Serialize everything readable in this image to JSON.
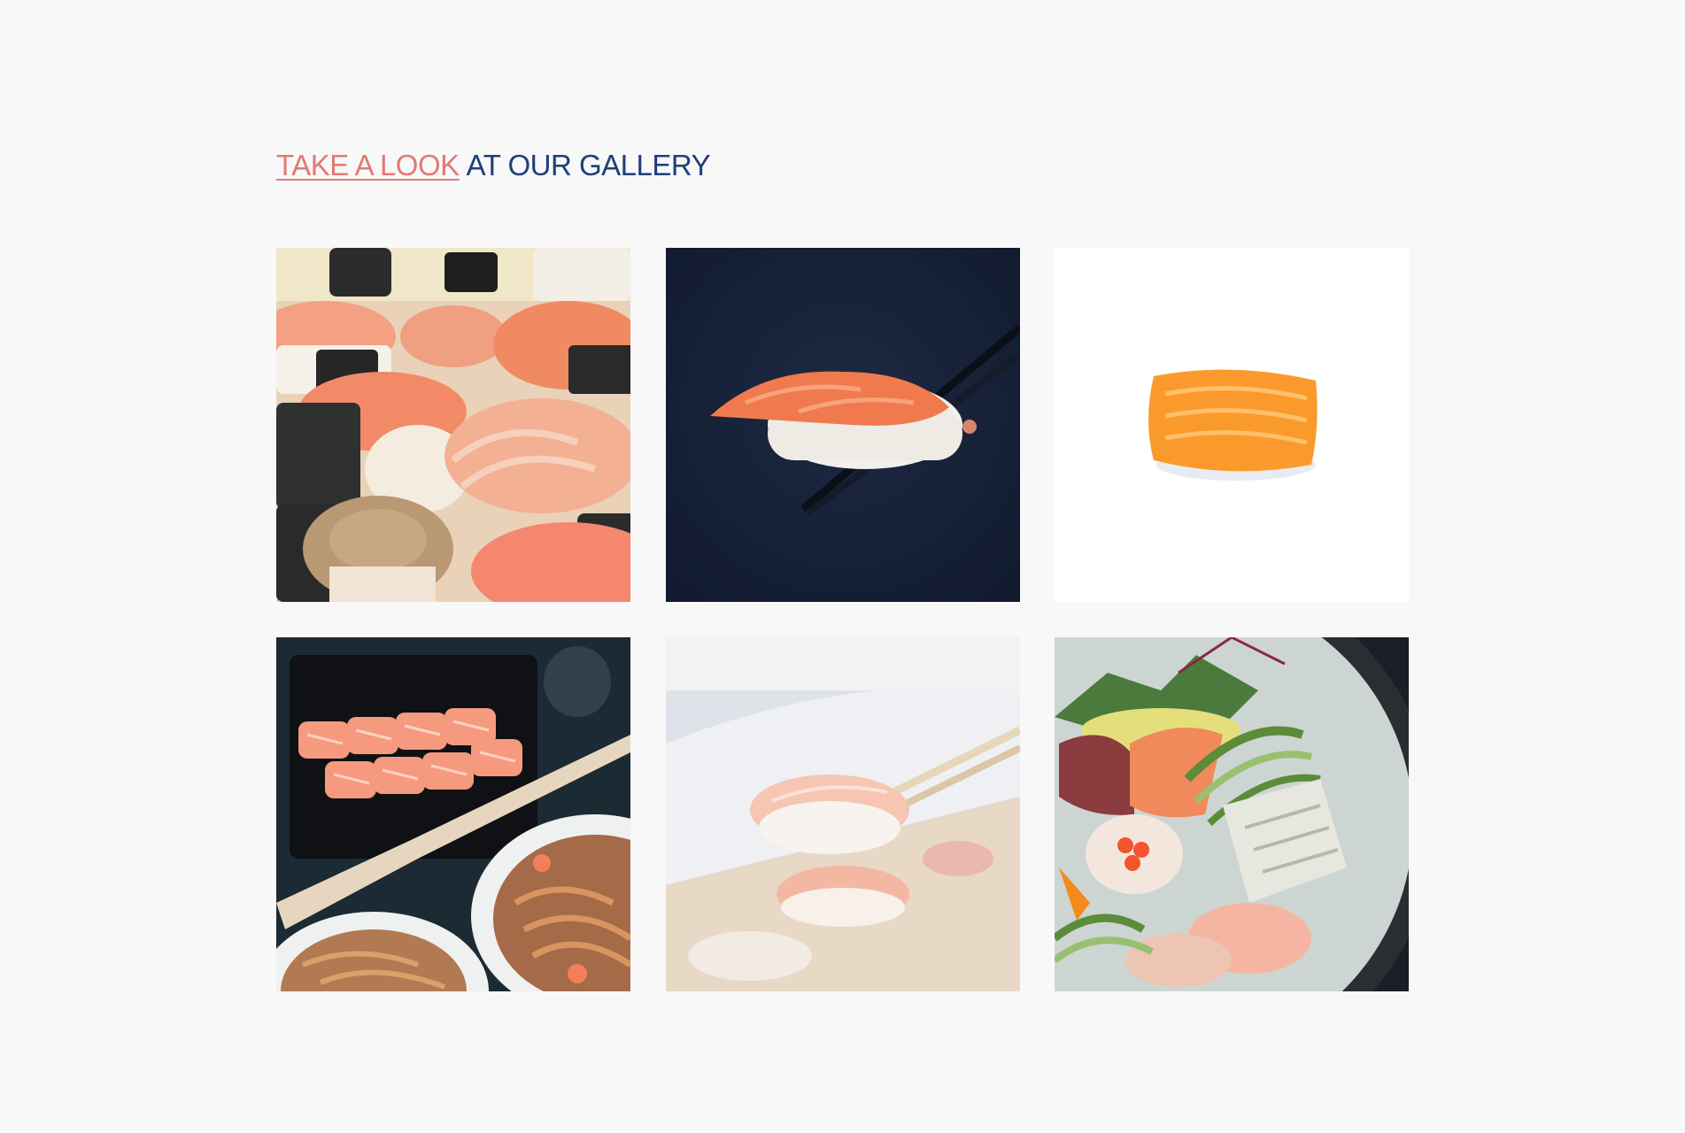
{
  "gallery": {
    "heading_link": "TAKE A LOOK",
    "heading_rest": "AT OUR GALLERY",
    "colors": {
      "link": "#e07a76",
      "heading": "#1f3f7a",
      "background": "#f8f8f8"
    }
  }
}
